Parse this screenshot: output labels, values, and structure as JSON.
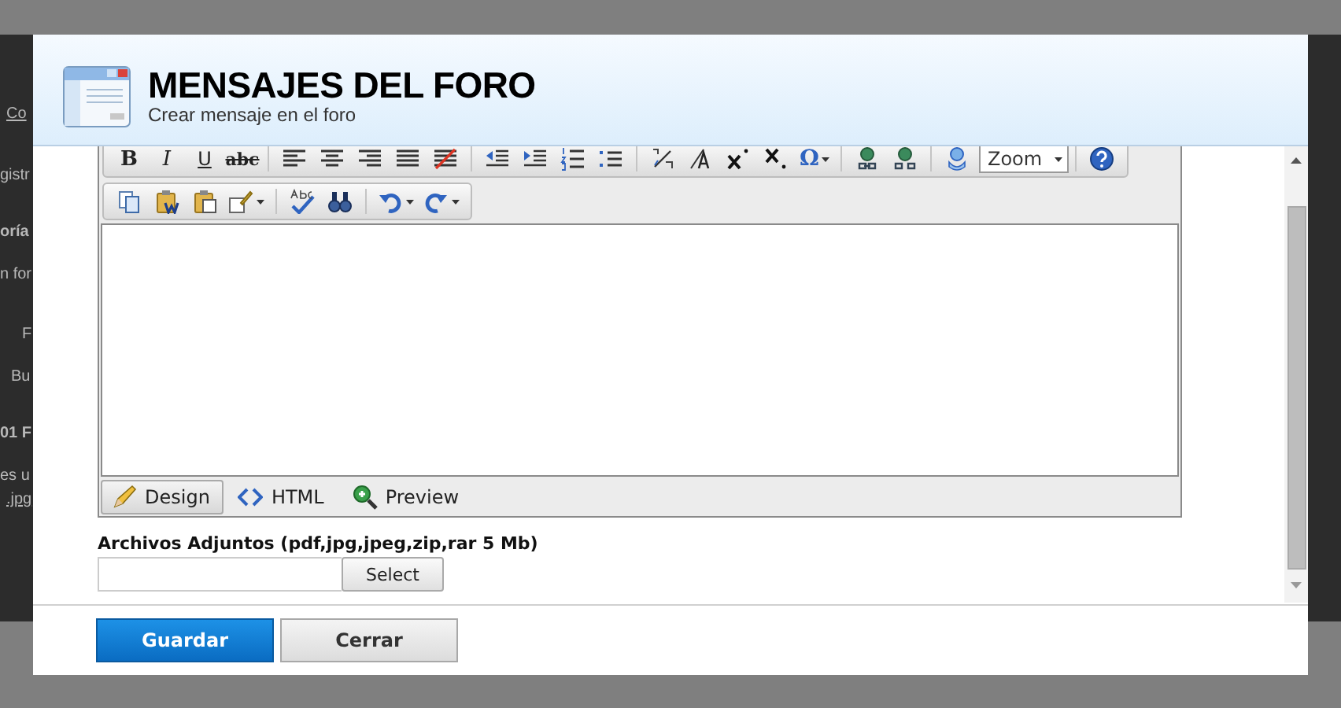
{
  "background_page": {
    "fragments": [
      {
        "text": "Co",
        "kind": "link"
      },
      {
        "text": "gistr",
        "kind": "plain"
      },
      {
        "text": "oría",
        "kind": "bold"
      },
      {
        "text": "n for",
        "kind": "plain"
      },
      {
        "text": "F",
        "kind": "plain"
      },
      {
        "text": "Bu",
        "kind": "plain"
      },
      {
        "text": "01 F",
        "kind": "bold"
      },
      {
        "text": "es u",
        "kind": "plain"
      },
      {
        "text": ".jpg",
        "kind": "link"
      }
    ]
  },
  "dialog": {
    "title": "MENSAJES DEL FORO",
    "subtitle": "Crear mensaje en el foro",
    "editor": {
      "format_buttons": [
        {
          "label": "B",
          "kind": "bold"
        },
        {
          "label": "I",
          "kind": "italic"
        },
        {
          "label": "U",
          "kind": "underline"
        },
        {
          "label": "abc",
          "kind": "strike"
        }
      ],
      "special_char_button": {
        "label": "Ω"
      },
      "zoom_select": {
        "value": "Zoom"
      },
      "modes": [
        {
          "label": "Design",
          "selected": true
        },
        {
          "label": "HTML",
          "selected": false
        },
        {
          "label": "Preview",
          "selected": false
        }
      ]
    },
    "attachments": {
      "label": "Archivos Adjuntos (pdf,jpg,jpeg,zip,rar 5 Mb)",
      "select_button": "Select"
    },
    "buttons": [
      {
        "label": "Guardar",
        "kind": "primary"
      },
      {
        "label": "Cerrar",
        "kind": "secondary"
      }
    ]
  }
}
